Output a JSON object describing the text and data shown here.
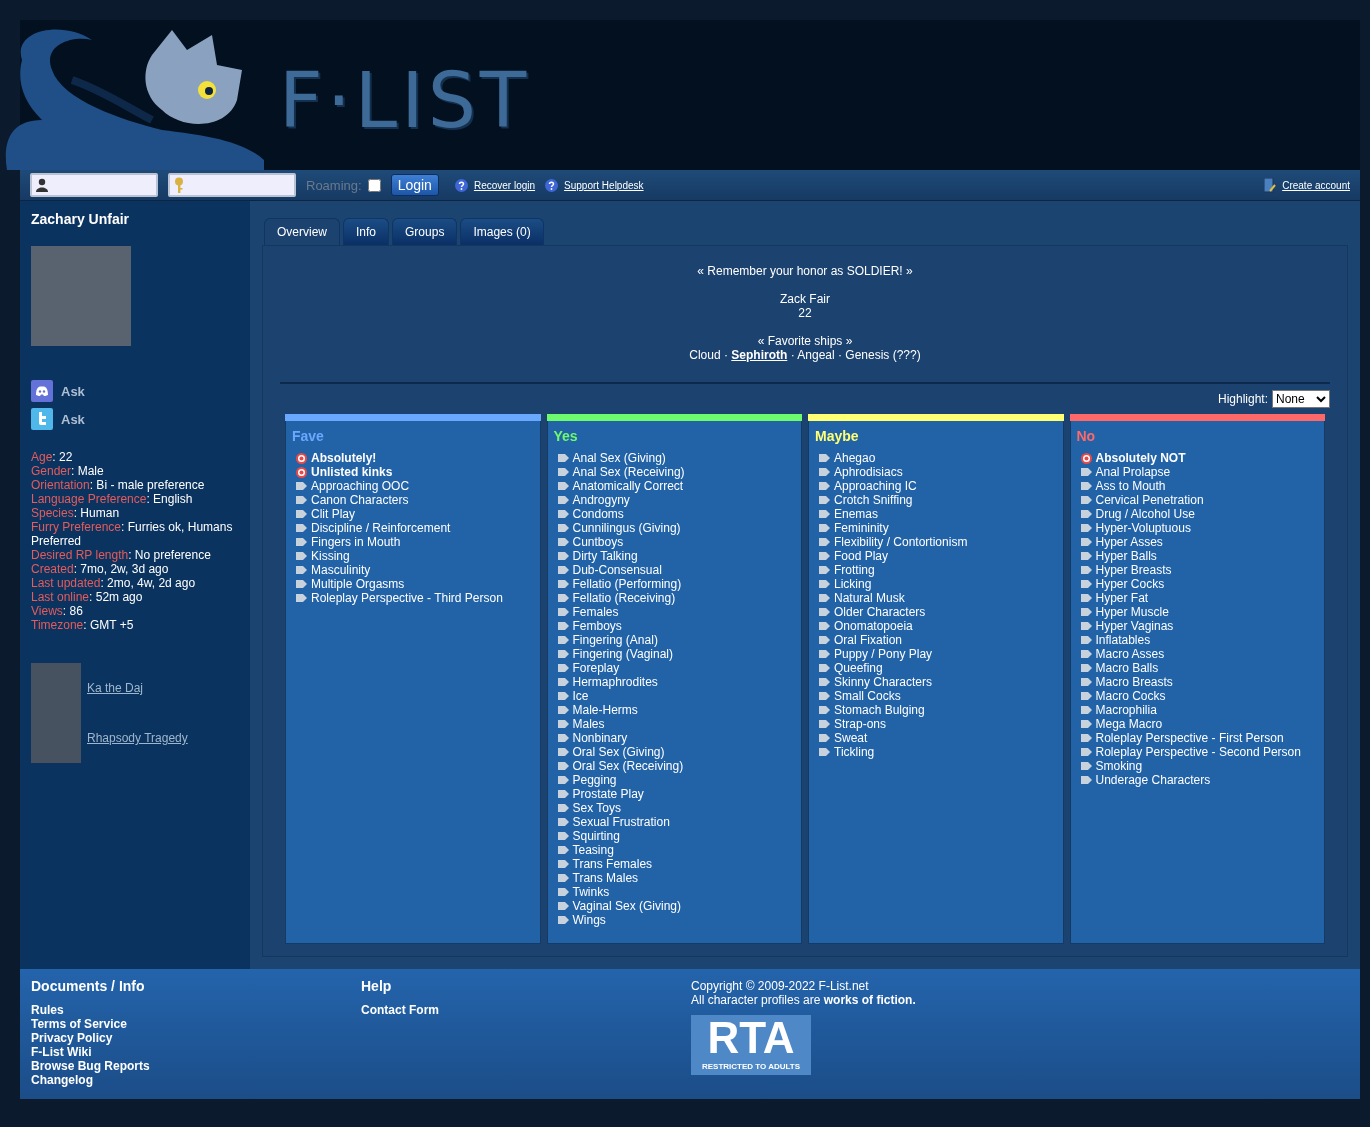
{
  "header": {
    "logo": "F·LIST"
  },
  "login_bar": {
    "roaming": {
      "label": "Roaming:",
      "checked": false
    },
    "login_button": "Login",
    "links": [
      {
        "label": "Recover login"
      },
      {
        "label": "Support Helpdesk"
      }
    ],
    "create_account": "Create account"
  },
  "sidebar": {
    "name": "Zachary Unfair",
    "contacts": [
      {
        "kind": "discord",
        "label": "Ask"
      },
      {
        "kind": "twitter",
        "label": "Ask"
      }
    ],
    "details": [
      {
        "label": "Age",
        "value": ": 22"
      },
      {
        "label": "Gender",
        "value": ": Male"
      },
      {
        "label": "Orientation",
        "value": ": Bi - male preference"
      },
      {
        "label": "Language Preference",
        "value": ": English"
      },
      {
        "label": "Species",
        "value": ": Human"
      },
      {
        "label": "Furry Preference",
        "value": ": Furries ok, Humans Preferred"
      },
      {
        "label": "Desired RP length",
        "value": ": No preference"
      },
      {
        "label": "Created",
        "value": ": 7mo, 2w, 3d ago"
      },
      {
        "label": "Last updated",
        "value": ": 2mo, 4w, 2d ago"
      },
      {
        "label": "Last online",
        "value": ": 52m ago"
      },
      {
        "label": "Views",
        "value": ": 86"
      },
      {
        "label": "Timezone",
        "value": ": GMT +5"
      }
    ],
    "friends": [
      {
        "name": "Ka the Daj"
      },
      {
        "name": "Rhapsody Tragedy"
      }
    ]
  },
  "tabs": [
    {
      "label": "Overview",
      "selected": true
    },
    {
      "label": "Info",
      "selected": false
    },
    {
      "label": "Groups",
      "selected": false
    },
    {
      "label": "Images (0)",
      "selected": false
    }
  ],
  "overview": {
    "quote": "« Remember your honor as SOLDIER! »",
    "character_name": "Zack Fair",
    "character_age": "22",
    "ships_title": "« Favorite ships »",
    "ships": "Cloud · **Sephiroth** · Angeal · Genesis (???)",
    "highlight": {
      "label": "Highlight:",
      "value": "None"
    },
    "columns": [
      {
        "title": "Fave",
        "color": "#6aa8ff",
        "items": [
          {
            "name": "Absolutely!",
            "kind": "custom"
          },
          {
            "name": "Unlisted kinks",
            "kind": "custom"
          },
          {
            "name": "Approaching OOC",
            "kind": "regular"
          },
          {
            "name": "Canon Characters",
            "kind": "regular"
          },
          {
            "name": "Clit Play",
            "kind": "regular"
          },
          {
            "name": "Discipline / Reinforcement",
            "kind": "regular"
          },
          {
            "name": "Fingers in Mouth",
            "kind": "regular"
          },
          {
            "name": "Kissing",
            "kind": "regular"
          },
          {
            "name": "Masculinity",
            "kind": "regular"
          },
          {
            "name": "Multiple Orgasms",
            "kind": "regular"
          },
          {
            "name": "Roleplay Perspective - Third Person",
            "kind": "regular"
          }
        ]
      },
      {
        "title": "Yes",
        "color": "#6dfa6d",
        "items": [
          {
            "name": "Anal Sex (Giving)",
            "kind": "regular"
          },
          {
            "name": "Anal Sex (Receiving)",
            "kind": "regular"
          },
          {
            "name": "Anatomically Correct",
            "kind": "regular"
          },
          {
            "name": "Androgyny",
            "kind": "regular"
          },
          {
            "name": "Condoms",
            "kind": "regular"
          },
          {
            "name": "Cunnilingus (Giving)",
            "kind": "regular"
          },
          {
            "name": "Cuntboys",
            "kind": "regular"
          },
          {
            "name": "Dirty Talking",
            "kind": "regular"
          },
          {
            "name": "Dub-Consensual",
            "kind": "regular"
          },
          {
            "name": "Fellatio (Performing)",
            "kind": "regular"
          },
          {
            "name": "Fellatio (Receiving)",
            "kind": "regular"
          },
          {
            "name": "Females",
            "kind": "regular"
          },
          {
            "name": "Femboys",
            "kind": "regular"
          },
          {
            "name": "Fingering (Anal)",
            "kind": "regular"
          },
          {
            "name": "Fingering (Vaginal)",
            "kind": "regular"
          },
          {
            "name": "Foreplay",
            "kind": "regular"
          },
          {
            "name": "Hermaphrodites",
            "kind": "regular"
          },
          {
            "name": "Ice",
            "kind": "regular"
          },
          {
            "name": "Male-Herms",
            "kind": "regular"
          },
          {
            "name": "Males",
            "kind": "regular"
          },
          {
            "name": "Nonbinary",
            "kind": "regular"
          },
          {
            "name": "Oral Sex (Giving)",
            "kind": "regular"
          },
          {
            "name": "Oral Sex (Receiving)",
            "kind": "regular"
          },
          {
            "name": "Pegging",
            "kind": "regular"
          },
          {
            "name": "Prostate Play",
            "kind": "regular"
          },
          {
            "name": "Sex Toys",
            "kind": "regular"
          },
          {
            "name": "Sexual Frustration",
            "kind": "regular"
          },
          {
            "name": "Squirting",
            "kind": "regular"
          },
          {
            "name": "Teasing",
            "kind": "regular"
          },
          {
            "name": "Trans Females",
            "kind": "regular"
          },
          {
            "name": "Trans Males",
            "kind": "regular"
          },
          {
            "name": "Twinks",
            "kind": "regular"
          },
          {
            "name": "Vaginal Sex (Giving)",
            "kind": "regular"
          },
          {
            "name": "Wings",
            "kind": "regular"
          }
        ]
      },
      {
        "title": "Maybe",
        "color": "#ffff73",
        "items": [
          {
            "name": "Ahegao",
            "kind": "regular"
          },
          {
            "name": "Aphrodisiacs",
            "kind": "regular"
          },
          {
            "name": "Approaching IC",
            "kind": "regular"
          },
          {
            "name": "Crotch Sniffing",
            "kind": "regular"
          },
          {
            "name": "Enemas",
            "kind": "regular"
          },
          {
            "name": "Femininity",
            "kind": "regular"
          },
          {
            "name": "Flexibility / Contortionism",
            "kind": "regular"
          },
          {
            "name": "Food Play",
            "kind": "regular"
          },
          {
            "name": "Frotting",
            "kind": "regular"
          },
          {
            "name": "Licking",
            "kind": "regular"
          },
          {
            "name": "Natural Musk",
            "kind": "regular"
          },
          {
            "name": "Older Characters",
            "kind": "regular"
          },
          {
            "name": "Onomatopoeia",
            "kind": "regular"
          },
          {
            "name": "Oral Fixation",
            "kind": "regular"
          },
          {
            "name": "Puppy / Pony Play",
            "kind": "regular"
          },
          {
            "name": "Queefing",
            "kind": "regular"
          },
          {
            "name": "Skinny Characters",
            "kind": "regular"
          },
          {
            "name": "Small Cocks",
            "kind": "regular"
          },
          {
            "name": "Stomach Bulging",
            "kind": "regular"
          },
          {
            "name": "Strap-ons",
            "kind": "regular"
          },
          {
            "name": "Sweat",
            "kind": "regular"
          },
          {
            "name": "Tickling",
            "kind": "regular"
          }
        ]
      },
      {
        "title": "No",
        "color": "#ff6868",
        "items": [
          {
            "name": "Absolutely NOT",
            "kind": "custom"
          },
          {
            "name": "Anal Prolapse",
            "kind": "regular"
          },
          {
            "name": "Ass to Mouth",
            "kind": "regular"
          },
          {
            "name": "Cervical Penetration",
            "kind": "regular"
          },
          {
            "name": "Drug / Alcohol Use",
            "kind": "regular"
          },
          {
            "name": "Hyper-Voluptuous",
            "kind": "regular"
          },
          {
            "name": "Hyper Asses",
            "kind": "regular"
          },
          {
            "name": "Hyper Balls",
            "kind": "regular"
          },
          {
            "name": "Hyper Breasts",
            "kind": "regular"
          },
          {
            "name": "Hyper Cocks",
            "kind": "regular"
          },
          {
            "name": "Hyper Fat",
            "kind": "regular"
          },
          {
            "name": "Hyper Muscle",
            "kind": "regular"
          },
          {
            "name": "Hyper Vaginas",
            "kind": "regular"
          },
          {
            "name": "Inflatables",
            "kind": "regular"
          },
          {
            "name": "Macro Asses",
            "kind": "regular"
          },
          {
            "name": "Macro Balls",
            "kind": "regular"
          },
          {
            "name": "Macro Breasts",
            "kind": "regular"
          },
          {
            "name": "Macro Cocks",
            "kind": "regular"
          },
          {
            "name": "Macrophilia",
            "kind": "regular"
          },
          {
            "name": "Mega Macro",
            "kind": "regular"
          },
          {
            "name": "Roleplay Perspective - First Person",
            "kind": "regular"
          },
          {
            "name": "Roleplay Perspective - Second Person",
            "kind": "regular"
          },
          {
            "name": "Smoking",
            "kind": "regular"
          },
          {
            "name": "Underage Characters",
            "kind": "regular"
          }
        ]
      }
    ]
  },
  "footer": {
    "sections": [
      {
        "title": "Documents / Info",
        "links": [
          "Rules",
          "Terms of Service",
          "Privacy Policy",
          "F-List Wiki",
          "Browse Bug Reports",
          "Changelog"
        ]
      },
      {
        "title": "Help",
        "links": [
          "Contact Form"
        ]
      }
    ],
    "copyright": "Copyright © 2009-2022 F-List.net",
    "notice": "All character profiles are **works of fiction.**",
    "badge": {
      "title": "RTA",
      "caption": "RESTRICTED TO ADULTS"
    }
  }
}
